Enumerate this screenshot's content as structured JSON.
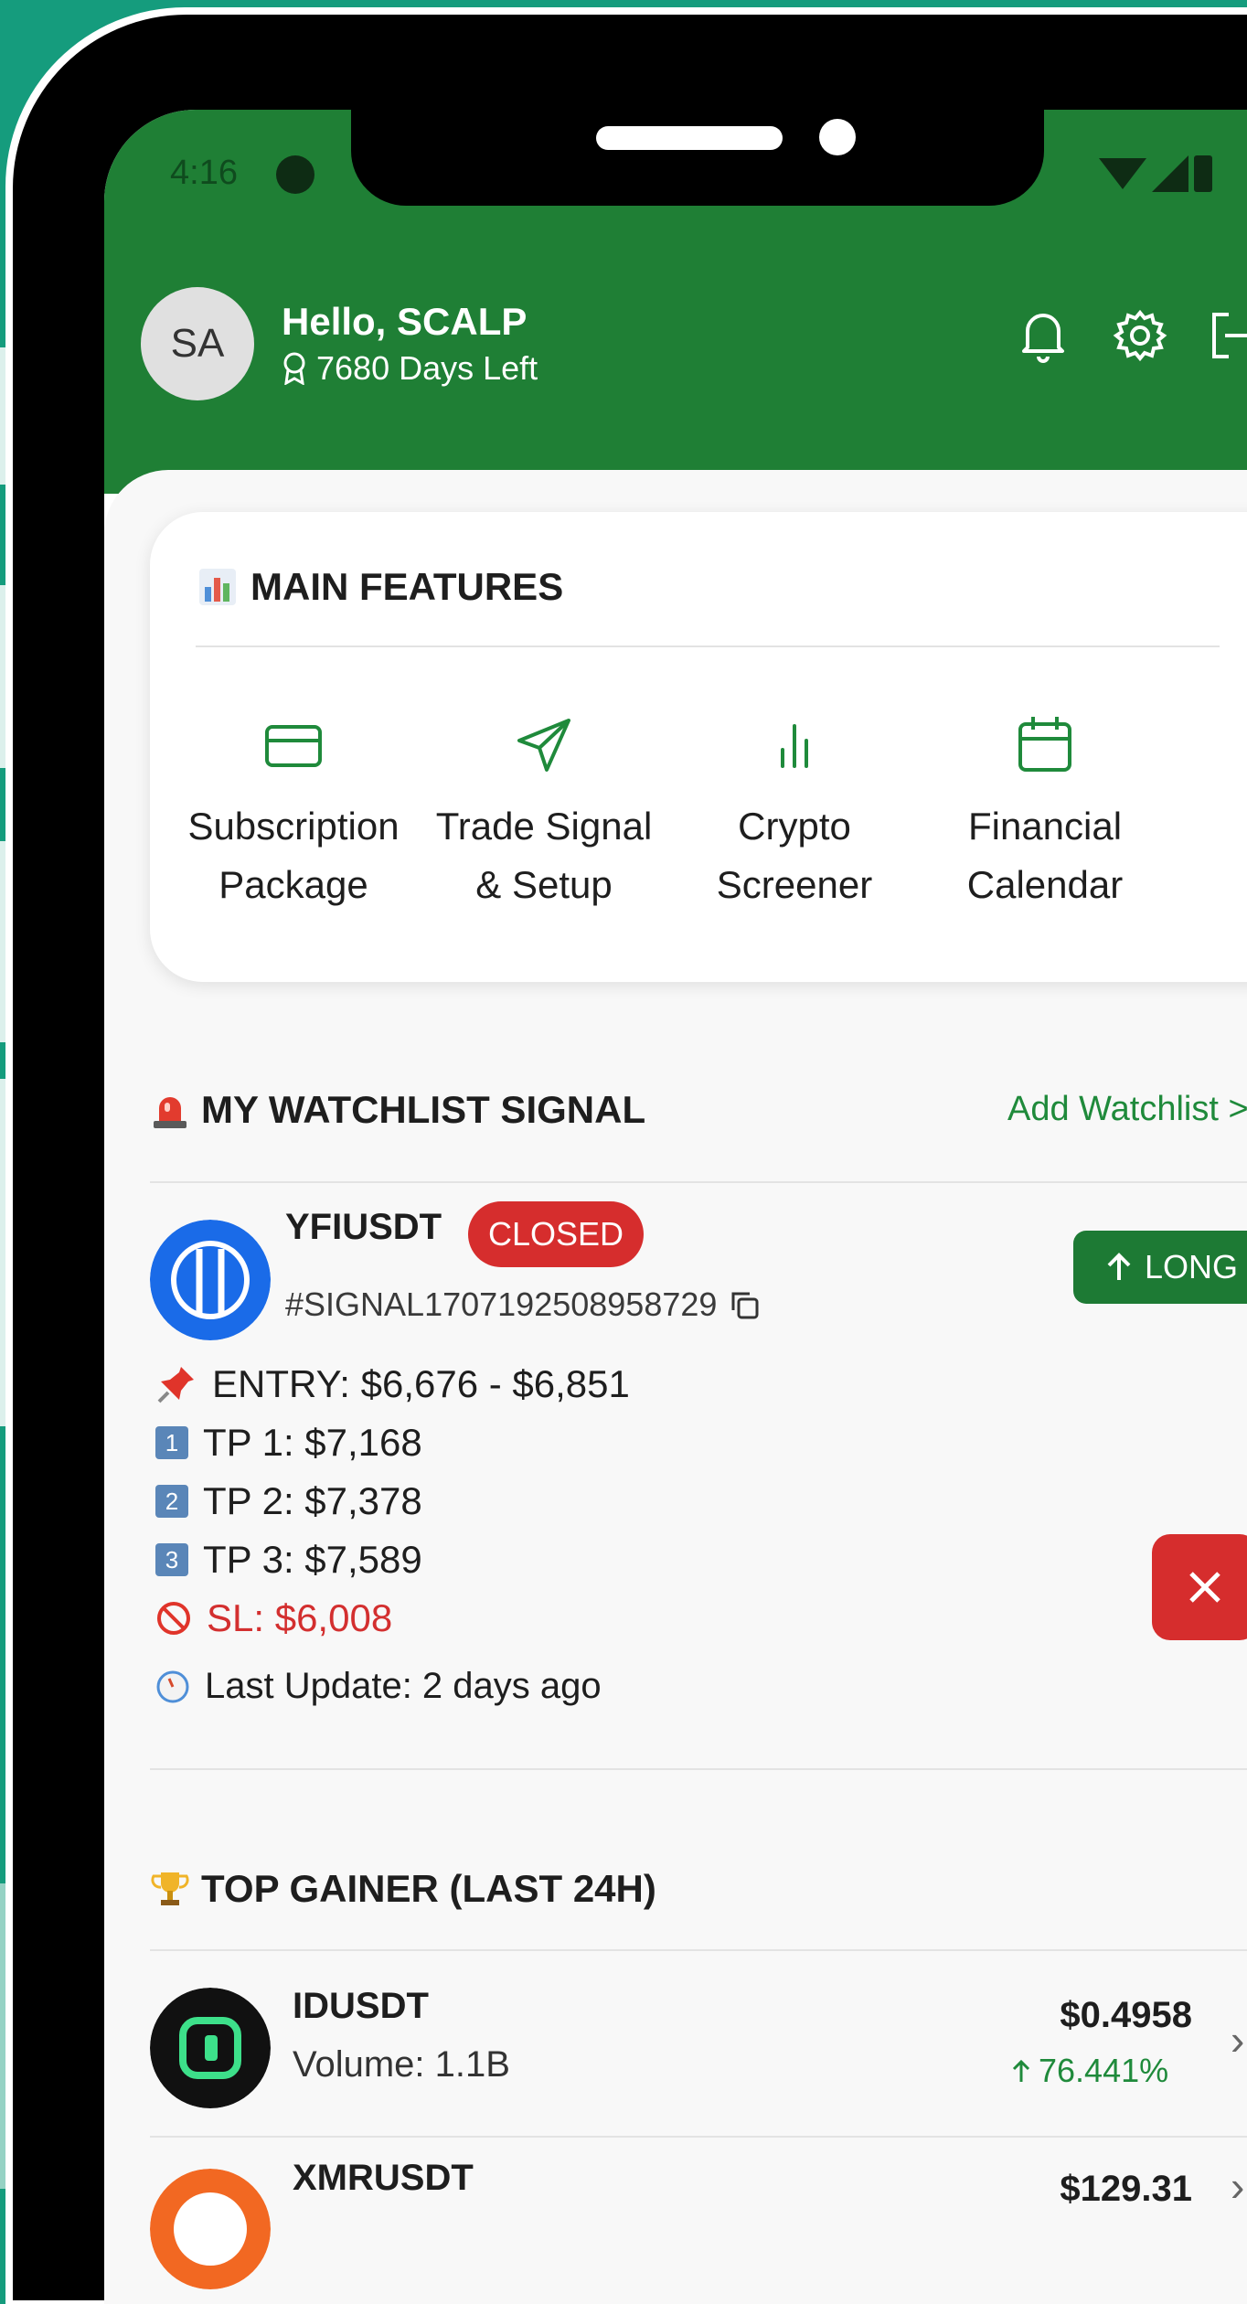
{
  "status": {
    "time": "4:16"
  },
  "user": {
    "avatar_initials": "SA",
    "greeting": "Hello, SCALP",
    "days_left": "7680 Days Left"
  },
  "header_icons": [
    "bell-icon",
    "gear-icon",
    "logout-icon"
  ],
  "main_features": {
    "title": "MAIN FEATURES",
    "items": [
      {
        "label_line1": "Subscription",
        "label_line2": "Package",
        "icon": "credit-card-icon"
      },
      {
        "label_line1": "Trade Signal",
        "label_line2": "& Setup",
        "icon": "send-icon"
      },
      {
        "label_line1": "Crypto",
        "label_line2": "Screener",
        "icon": "bar-chart-icon"
      },
      {
        "label_line1": "Financial",
        "label_line2": "Calendar",
        "icon": "calendar-icon"
      }
    ]
  },
  "watchlist": {
    "title": "MY WATCHLIST SIGNAL",
    "add_label": "Add Watchlist >",
    "signal": {
      "symbol": "YFIUSDT",
      "status": "CLOSED",
      "id": "#SIGNAL1707192508958729",
      "direction": "LONG",
      "entry": "ENTRY: $6,676 - $6,851",
      "tp1": "TP 1: $7,168",
      "tp2": "TP 2: $7,378",
      "tp3": "TP 3: $7,589",
      "sl": "SL: $6,008",
      "last_update": "Last Update: 2 days ago",
      "tp_numbers": [
        "1",
        "2",
        "3"
      ]
    }
  },
  "top_gainer": {
    "title": "TOP GAINER (LAST 24H)",
    "items": [
      {
        "symbol": "IDUSDT",
        "volume": "Volume: 1.1B",
        "price": "$0.4958",
        "change": "76.441%"
      },
      {
        "symbol": "XMRUSDT",
        "price": "$129.31"
      }
    ]
  },
  "colors": {
    "brand_green": "#1f7f35",
    "closed_red": "#d62d2d",
    "positive_green": "#1f8a3b",
    "background_teal": "#159c7d"
  }
}
